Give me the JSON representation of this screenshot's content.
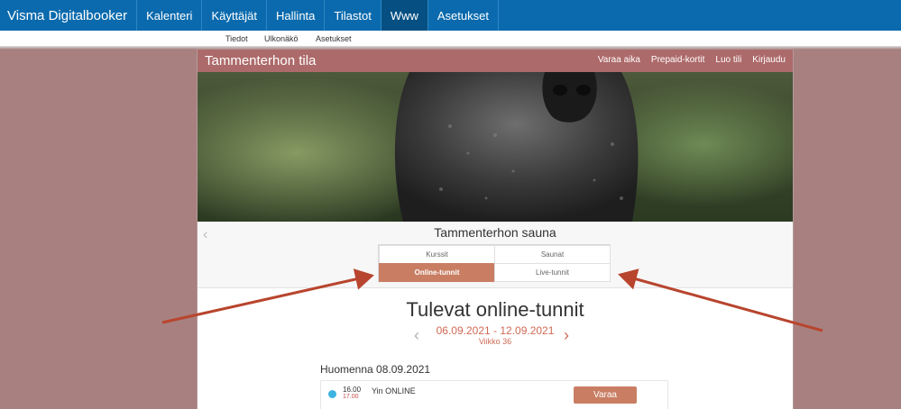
{
  "app": {
    "brand": "Visma Digitalbooker",
    "nav": [
      "Kalenteri",
      "Käyttäjät",
      "Hallinta",
      "Tilastot",
      "Www",
      "Asetukset"
    ],
    "active_nav": "Www",
    "subnav": [
      "Tiedot",
      "Ulkonäkö",
      "Asetukset"
    ]
  },
  "site": {
    "title": "Tammenterhon tila",
    "links": [
      "Varaa aika",
      "Prepaid-kortit",
      "Luo tili",
      "Kirjaudu"
    ],
    "venue": "Tammenterhon sauna",
    "tabs": [
      "Kurssit",
      "Saunat",
      "Online-tunnit",
      "Live-tunnit"
    ],
    "active_tab": "Online-tunnit"
  },
  "schedule": {
    "heading": "Tulevat online-tunnit",
    "dates": "06.09.2021 - 12.09.2021",
    "week": "Viikko 36",
    "day": "Huomenna 08.09.2021",
    "slots": [
      {
        "start": "16.00",
        "end": "17.00",
        "name": "Yin ONLINE",
        "action": "Varaa"
      }
    ]
  },
  "colors": {
    "nav_bg": "#0a6aad",
    "site_header": "#ad6a6a",
    "accent": "#c97e63",
    "annotation_arrow": "#b8452e"
  },
  "icons": {
    "prev": "chevron-left-icon",
    "next": "chevron-right-icon",
    "status": "online-dot-icon"
  }
}
